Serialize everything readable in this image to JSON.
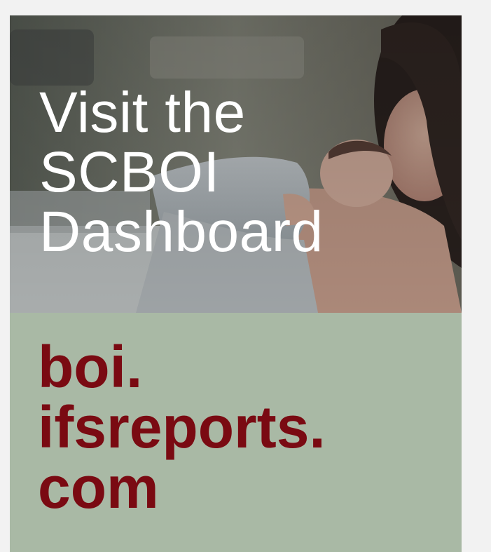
{
  "hero": {
    "image_description_icon": "mother-holding-newborn-photo",
    "title_lines": [
      "Visit the",
      "SCBOI",
      "Dashboard"
    ]
  },
  "url": {
    "lines": [
      "boi.",
      "ifsreports.",
      "com"
    ]
  },
  "colors": {
    "page_background": "#f2f2f2",
    "panel_background": "#a9b9a5",
    "url_text": "#7a0a12",
    "hero_title_text": "#ffffff"
  }
}
